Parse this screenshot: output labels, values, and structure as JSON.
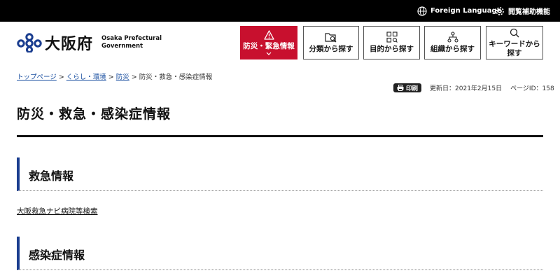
{
  "topbar": {
    "foreign_language": "Foreign Language",
    "accessibility": "閲覧補助機能"
  },
  "logo": {
    "name_ja": "大阪府",
    "name_en_line1": "Osaka Prefectural",
    "name_en_line2": "Government"
  },
  "nav": {
    "bousai": "防災・緊急情報",
    "bunrui": "分類から探す",
    "mokuteki": "目的から探す",
    "soshiki": "組織から探す",
    "keyword_line1": "キーワードから",
    "keyword_line2": "探す"
  },
  "breadcrumb": {
    "items": [
      "トップページ",
      "くらし・環境",
      "防災"
    ],
    "current": "防災・救急・感染症情報",
    "separator": ">"
  },
  "meta": {
    "print": "印刷",
    "updated": "更新日：2021年2月15日",
    "page_id": "ページID：158"
  },
  "page": {
    "title": "防災・救急・感染症情報"
  },
  "sections": [
    {
      "heading": "救急情報",
      "links": [
        "大阪救急ナビ病院等検索"
      ]
    },
    {
      "heading": "感染症情報"
    }
  ],
  "colors": {
    "emergency_red": "#c8102e",
    "accent_navy": "#1a3d8f",
    "link_blue": "#1a4fa0",
    "topbar": "#000000"
  },
  "icons": {
    "foreign_language": "globe-icon",
    "accessibility": "gear-icon",
    "bousai": "warning-triangle-icon",
    "bousai_toggle": "chevron-down-icon",
    "bunrui": "folder-search-icon",
    "mokuteki": "grid-icon",
    "soshiki": "org-chart-icon",
    "keyword": "search-icon",
    "print": "printer-icon"
  }
}
